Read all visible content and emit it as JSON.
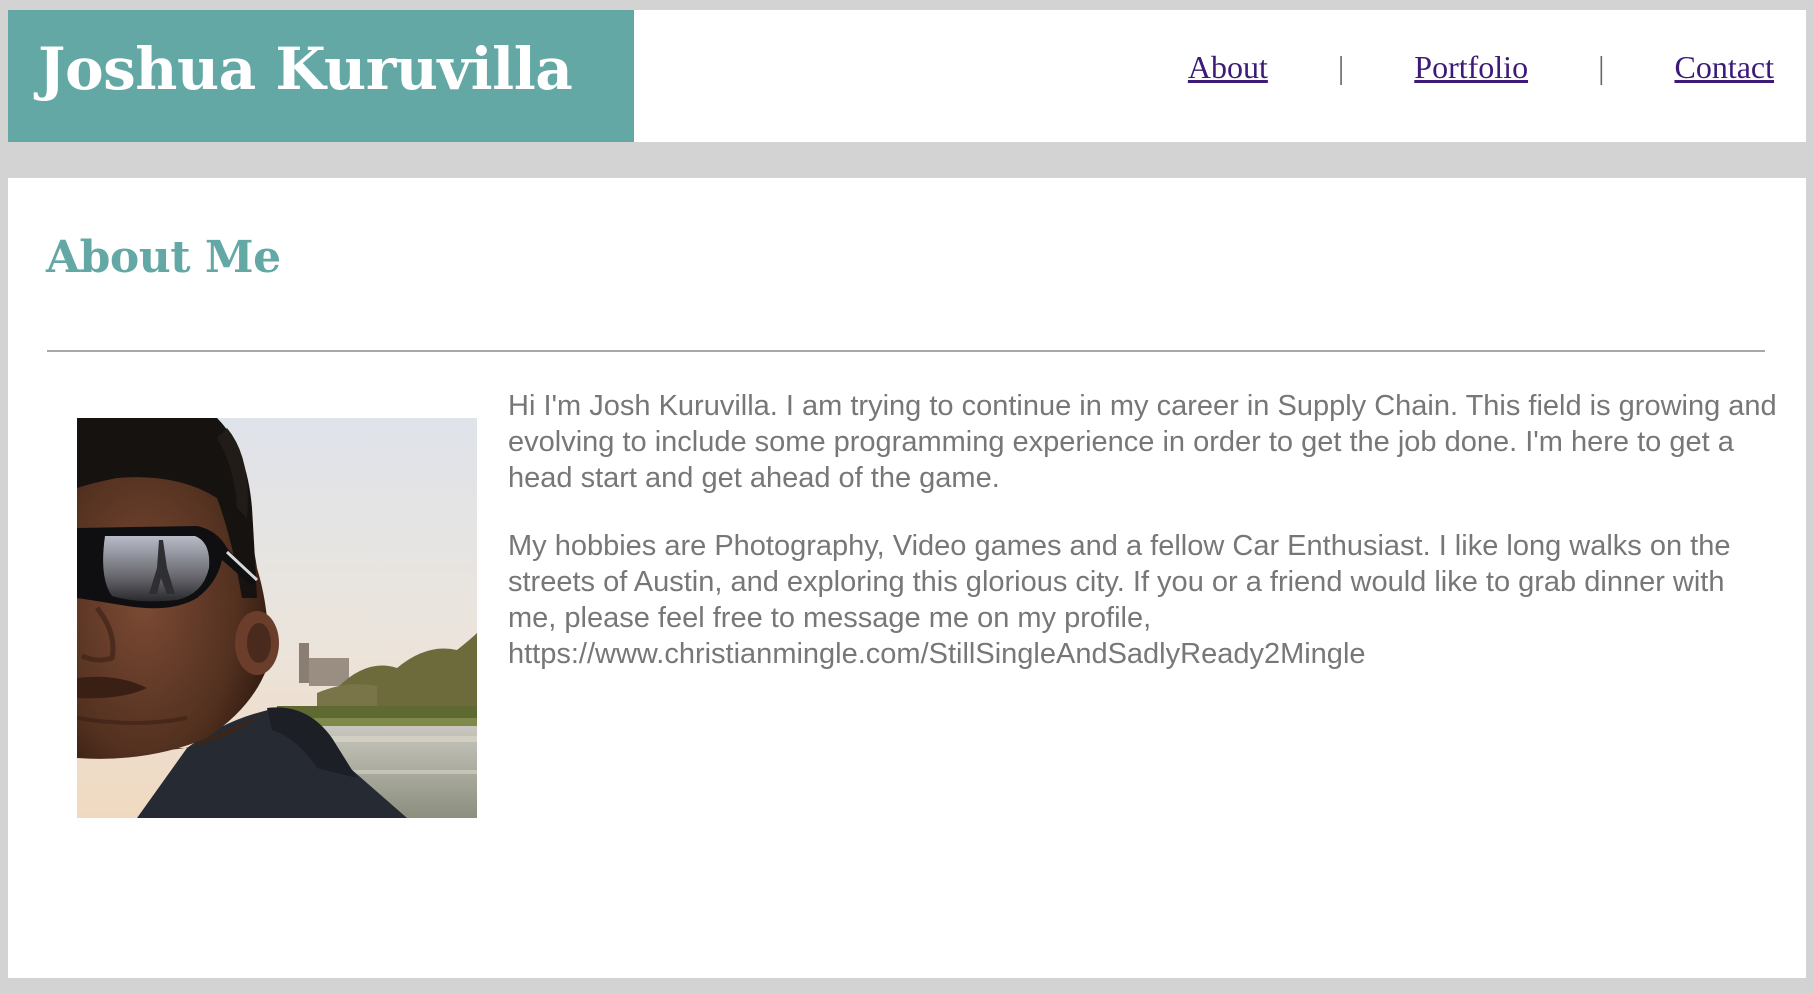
{
  "site": {
    "name": "Joshua Kuruvilla"
  },
  "nav": {
    "items": [
      {
        "label": "About"
      },
      {
        "label": "Portfolio"
      },
      {
        "label": "Contact"
      }
    ],
    "separator": "|"
  },
  "about": {
    "title": "About Me",
    "paragraphs": [
      "Hi I'm Josh Kuruvilla. I am trying to continue in my career in Supply Chain. This field is growing and evolving to include some programming experience in order to get the job done. I'm here to get a head start and get ahead of the game.",
      "My hobbies are Photography, Video games and a fellow Car Enthusiast. I like long walks on the streets of Austin, and exploring this glorious city. If you or a friend would like to grab dinner with me, please feel free to message me on my profile, https://www.christianmingle.com/StillSingleAndSadlyReady2Mingle"
    ]
  },
  "colors": {
    "accent": "#63a8a5",
    "page_background": "#d3d3d3",
    "nav_link": "#3d1a78",
    "body_text": "#777777"
  }
}
